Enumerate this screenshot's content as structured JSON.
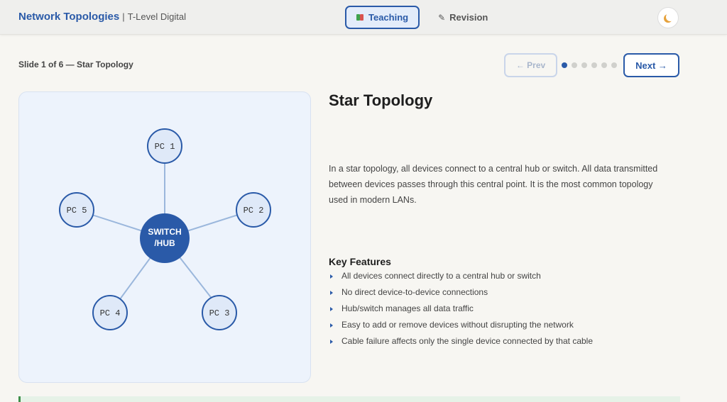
{
  "header": {
    "title": "Network Topologies",
    "separator": "|",
    "subtitle": "T-Level Digital",
    "tabs": [
      {
        "label": "Teaching",
        "icon": "book-icon",
        "active": true
      },
      {
        "label": "Revision",
        "icon": "pencil-icon",
        "active": false
      }
    ],
    "theme_icon": "moon-icon"
  },
  "nav": {
    "slide_label": "Slide 1 of 6 — Star Topology",
    "prev_label": "← Prev",
    "next_label": "Next →",
    "total_slides": 6,
    "current_slide": 1
  },
  "diagram": {
    "hub_label_line1": "SWITCH",
    "hub_label_line2": "/HUB",
    "nodes": [
      "PC 1",
      "PC 2",
      "PC 3",
      "PC 4",
      "PC 5"
    ]
  },
  "content": {
    "title": "Star Topology",
    "description": "In a star topology, all devices connect to a central hub or switch. All data transmitted between devices passes through this central point. It is the most common topology used in modern LANs.",
    "features_title": "Key Features",
    "features": [
      "All devices connect directly to a central hub or switch",
      "No direct device-to-device connections",
      "Hub/switch manages all data traffic",
      "Easy to add or remove devices without disrupting the network",
      "Cable failure affects only the single device connected by that cable"
    ]
  },
  "colors": {
    "accent": "#2a5aa8",
    "node_fill": "#dfe9f8",
    "link": "#9bb7dc",
    "panel": "#edf3fc",
    "banner": "#e6f2e7"
  }
}
